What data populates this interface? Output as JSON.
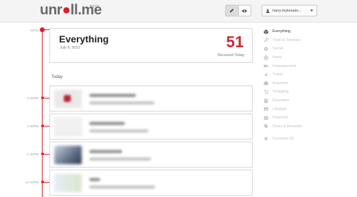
{
  "app": {
    "logo_text": "unroll.me",
    "beta_label": "BETA"
  },
  "header": {
    "user_name": "harry.mylonade..."
  },
  "timeline": {
    "now_label": "NOW",
    "entries": [
      {
        "time": "1:00PM"
      },
      {
        "time": "1:30PM"
      },
      {
        "time": "1:30PM"
      },
      {
        "time": "12:30PM"
      }
    ]
  },
  "summary": {
    "title": "Everything",
    "date": "July 9, 2012",
    "count": "51",
    "caption": "Received Today"
  },
  "section_label": "Today",
  "sidebar": {
    "items": [
      {
        "label": "Everything",
        "icon": "box-icon",
        "active": true
      },
      {
        "label": "Tools & Services",
        "icon": "wrench-icon",
        "active": false
      },
      {
        "label": "Social",
        "icon": "social-icon",
        "active": false
      },
      {
        "label": "News",
        "icon": "globe-icon",
        "active": false
      },
      {
        "label": "Entertainment",
        "icon": "video-camera-icon",
        "active": false
      },
      {
        "label": "Travel",
        "icon": "plane-icon",
        "active": false
      },
      {
        "label": "Business",
        "icon": "briefcase-icon",
        "active": false
      },
      {
        "label": "Shopping",
        "icon": "shopping-cart-icon",
        "active": false
      },
      {
        "label": "Education",
        "icon": "book-icon",
        "active": false
      },
      {
        "label": "Lifestyle",
        "icon": "lifestyle-icon",
        "active": false
      },
      {
        "label": "Financial",
        "icon": "financial-icon",
        "active": false
      },
      {
        "label": "Deals & Rewards",
        "icon": "tag-icon",
        "active": false
      }
    ],
    "favorites_label": "Favorites (0)"
  },
  "colors": {
    "accent": "#e01b2e",
    "count": "#cc2a36"
  }
}
